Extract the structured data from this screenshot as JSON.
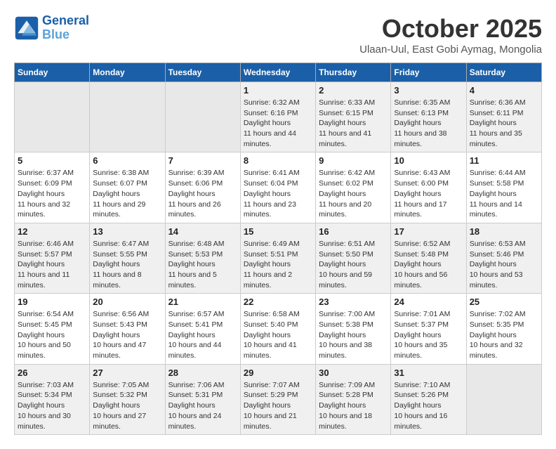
{
  "header": {
    "logo_line1": "General",
    "logo_line2": "Blue",
    "month_title": "October 2025",
    "subtitle": "Ulaan-Uul, East Gobi Aymag, Mongolia"
  },
  "weekdays": [
    "Sunday",
    "Monday",
    "Tuesday",
    "Wednesday",
    "Thursday",
    "Friday",
    "Saturday"
  ],
  "weeks": [
    [
      {
        "day": null
      },
      {
        "day": null
      },
      {
        "day": null
      },
      {
        "day": "1",
        "sunrise": "6:32 AM",
        "sunset": "6:16 PM",
        "daylight": "11 hours and 44 minutes."
      },
      {
        "day": "2",
        "sunrise": "6:33 AM",
        "sunset": "6:15 PM",
        "daylight": "11 hours and 41 minutes."
      },
      {
        "day": "3",
        "sunrise": "6:35 AM",
        "sunset": "6:13 PM",
        "daylight": "11 hours and 38 minutes."
      },
      {
        "day": "4",
        "sunrise": "6:36 AM",
        "sunset": "6:11 PM",
        "daylight": "11 hours and 35 minutes."
      }
    ],
    [
      {
        "day": "5",
        "sunrise": "6:37 AM",
        "sunset": "6:09 PM",
        "daylight": "11 hours and 32 minutes."
      },
      {
        "day": "6",
        "sunrise": "6:38 AM",
        "sunset": "6:07 PM",
        "daylight": "11 hours and 29 minutes."
      },
      {
        "day": "7",
        "sunrise": "6:39 AM",
        "sunset": "6:06 PM",
        "daylight": "11 hours and 26 minutes."
      },
      {
        "day": "8",
        "sunrise": "6:41 AM",
        "sunset": "6:04 PM",
        "daylight": "11 hours and 23 minutes."
      },
      {
        "day": "9",
        "sunrise": "6:42 AM",
        "sunset": "6:02 PM",
        "daylight": "11 hours and 20 minutes."
      },
      {
        "day": "10",
        "sunrise": "6:43 AM",
        "sunset": "6:00 PM",
        "daylight": "11 hours and 17 minutes."
      },
      {
        "day": "11",
        "sunrise": "6:44 AM",
        "sunset": "5:58 PM",
        "daylight": "11 hours and 14 minutes."
      }
    ],
    [
      {
        "day": "12",
        "sunrise": "6:46 AM",
        "sunset": "5:57 PM",
        "daylight": "11 hours and 11 minutes."
      },
      {
        "day": "13",
        "sunrise": "6:47 AM",
        "sunset": "5:55 PM",
        "daylight": "11 hours and 8 minutes."
      },
      {
        "day": "14",
        "sunrise": "6:48 AM",
        "sunset": "5:53 PM",
        "daylight": "11 hours and 5 minutes."
      },
      {
        "day": "15",
        "sunrise": "6:49 AM",
        "sunset": "5:51 PM",
        "daylight": "11 hours and 2 minutes."
      },
      {
        "day": "16",
        "sunrise": "6:51 AM",
        "sunset": "5:50 PM",
        "daylight": "10 hours and 59 minutes."
      },
      {
        "day": "17",
        "sunrise": "6:52 AM",
        "sunset": "5:48 PM",
        "daylight": "10 hours and 56 minutes."
      },
      {
        "day": "18",
        "sunrise": "6:53 AM",
        "sunset": "5:46 PM",
        "daylight": "10 hours and 53 minutes."
      }
    ],
    [
      {
        "day": "19",
        "sunrise": "6:54 AM",
        "sunset": "5:45 PM",
        "daylight": "10 hours and 50 minutes."
      },
      {
        "day": "20",
        "sunrise": "6:56 AM",
        "sunset": "5:43 PM",
        "daylight": "10 hours and 47 minutes."
      },
      {
        "day": "21",
        "sunrise": "6:57 AM",
        "sunset": "5:41 PM",
        "daylight": "10 hours and 44 minutes."
      },
      {
        "day": "22",
        "sunrise": "6:58 AM",
        "sunset": "5:40 PM",
        "daylight": "10 hours and 41 minutes."
      },
      {
        "day": "23",
        "sunrise": "7:00 AM",
        "sunset": "5:38 PM",
        "daylight": "10 hours and 38 minutes."
      },
      {
        "day": "24",
        "sunrise": "7:01 AM",
        "sunset": "5:37 PM",
        "daylight": "10 hours and 35 minutes."
      },
      {
        "day": "25",
        "sunrise": "7:02 AM",
        "sunset": "5:35 PM",
        "daylight": "10 hours and 32 minutes."
      }
    ],
    [
      {
        "day": "26",
        "sunrise": "7:03 AM",
        "sunset": "5:34 PM",
        "daylight": "10 hours and 30 minutes."
      },
      {
        "day": "27",
        "sunrise": "7:05 AM",
        "sunset": "5:32 PM",
        "daylight": "10 hours and 27 minutes."
      },
      {
        "day": "28",
        "sunrise": "7:06 AM",
        "sunset": "5:31 PM",
        "daylight": "10 hours and 24 minutes."
      },
      {
        "day": "29",
        "sunrise": "7:07 AM",
        "sunset": "5:29 PM",
        "daylight": "10 hours and 21 minutes."
      },
      {
        "day": "30",
        "sunrise": "7:09 AM",
        "sunset": "5:28 PM",
        "daylight": "10 hours and 18 minutes."
      },
      {
        "day": "31",
        "sunrise": "7:10 AM",
        "sunset": "5:26 PM",
        "daylight": "10 hours and 16 minutes."
      },
      {
        "day": null
      }
    ]
  ]
}
